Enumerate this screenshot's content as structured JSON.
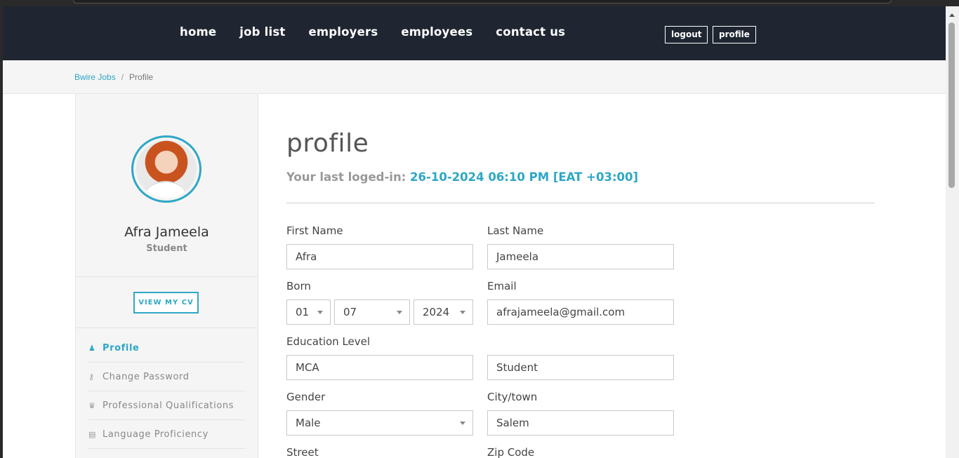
{
  "nav": {
    "links": [
      "home",
      "job list",
      "employers",
      "employees",
      "contact us"
    ],
    "logout_label": "logout",
    "profile_label": "profile"
  },
  "breadcrumb": {
    "root": "Bwire Jobs",
    "separator": "/",
    "current": "Profile"
  },
  "sidebar": {
    "user_name": "Afra Jameela",
    "user_role": "Student",
    "cv_button": "VIEW MY CV",
    "menu": [
      {
        "label": "Profile",
        "icon": "user-icon",
        "active": true
      },
      {
        "label": "Change Password",
        "icon": "key-icon",
        "active": false
      },
      {
        "label": "Professional Qualifications",
        "icon": "trophy-icon",
        "active": false
      },
      {
        "label": "Language Proficiency",
        "icon": "language-icon",
        "active": false
      }
    ]
  },
  "main": {
    "title": "profile",
    "last_login_label": "Your last loged-in:",
    "last_login_value": "26-10-2024 06:10 PM [EAT +03:00]"
  },
  "form": {
    "first_name": {
      "label": "First Name",
      "value": "Afra"
    },
    "last_name": {
      "label": "Last Name",
      "value": "Jameela"
    },
    "born": {
      "label": "Born",
      "day": "01",
      "month": "07",
      "year": "2024"
    },
    "email": {
      "label": "Email",
      "value": "afrajameela@gmail.com"
    },
    "education": {
      "label": "Education Level",
      "value": "MCA"
    },
    "occupation": {
      "value": "Student"
    },
    "gender": {
      "label": "Gender",
      "value": "Male"
    },
    "city": {
      "label": "City/town",
      "value": "Salem"
    },
    "street": {
      "label": "Street"
    },
    "zip": {
      "label": "Zip Code"
    }
  },
  "colors": {
    "accent": "#2ea7c6",
    "navbar": "#1f2631",
    "background": "#f5f5f5"
  }
}
